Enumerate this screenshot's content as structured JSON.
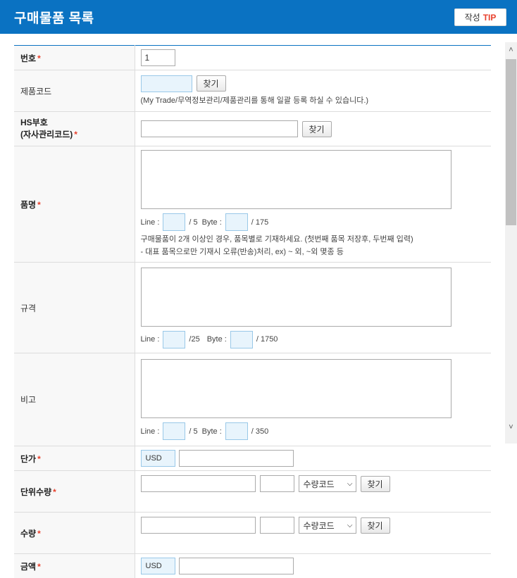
{
  "header": {
    "title": "구매물품 목록",
    "tip_prefix": "작성",
    "tip_label": "TIP"
  },
  "rows": {
    "no": {
      "label": "번호",
      "value": "1"
    },
    "product_code": {
      "label": "제품코드",
      "button": "찾기",
      "note": "(My Trade/무역정보관리/제품관리를 통해 일괄 등록 하실 수 있습니다.)"
    },
    "hs": {
      "label_line1": "HS부호",
      "label_line2": "(자사관리코드)",
      "button": "찾기"
    },
    "item_name": {
      "label": "품명",
      "line_label": "Line :",
      "line_max": "/ 5",
      "byte_label": "Byte :",
      "byte_max": "/ 175",
      "note_line1": "구매물품이 2개 이상인 경우, 품목별로 기재하세요. (첫번째 품목 저장후, 두번째 입력)",
      "note_line2": "- 대표 품목으로만 기재시 오류(반송)처리, ex) ~ 외, ~외 몇종 등"
    },
    "spec": {
      "label": "규격",
      "line_label": "Line :",
      "line_max": "/25",
      "byte_label": "Byte :",
      "byte_max": "/ 1750"
    },
    "remarks": {
      "label": "비고",
      "line_label": "Line :",
      "line_max": "/ 5",
      "byte_label": "Byte :",
      "byte_max": "/ 350"
    },
    "unit_price": {
      "label": "단가",
      "currency": "USD"
    },
    "unit_qty": {
      "label": "단위수량",
      "select": "수량코드",
      "button": "찾기"
    },
    "qty": {
      "label": "수량",
      "select": "수량코드",
      "button": "찾기"
    },
    "amount": {
      "label": "금액",
      "currency": "USD"
    }
  },
  "required_mark": "*"
}
